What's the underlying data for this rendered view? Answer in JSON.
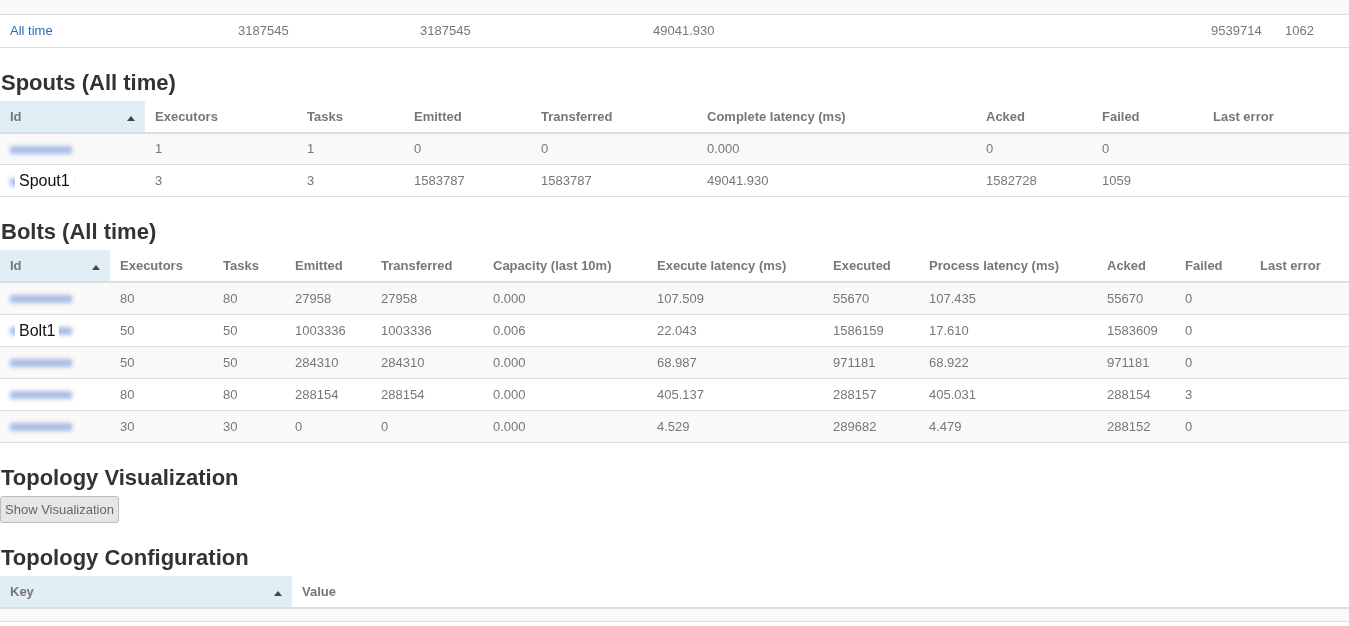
{
  "stats_table": {
    "rows": [
      {
        "window": "All time",
        "cells": [
          "3187545",
          "3187545",
          "49041.930",
          "",
          "9539714",
          "1062"
        ]
      }
    ]
  },
  "spouts": {
    "title": "Spouts (All time)",
    "columns": [
      {
        "label": "Id",
        "sorted": true
      },
      {
        "label": "Executors",
        "sorted": false
      },
      {
        "label": "Tasks",
        "sorted": false
      },
      {
        "label": "Emitted",
        "sorted": false
      },
      {
        "label": "Transferred",
        "sorted": false
      },
      {
        "label": "Complete latency (ms)",
        "sorted": false
      },
      {
        "label": "Acked",
        "sorted": false
      },
      {
        "label": "Failed",
        "sorted": false
      },
      {
        "label": "Last error",
        "sorted": false
      }
    ],
    "rows": [
      {
        "redacted": true,
        "cells": [
          "",
          "1",
          "1",
          "0",
          "0",
          "0.000",
          "0",
          "0",
          ""
        ]
      },
      {
        "redacted": true,
        "cells": [
          "Spout1",
          "3",
          "3",
          "1583787",
          "1583787",
          "49041.930",
          "1582728",
          "1059",
          ""
        ]
      }
    ]
  },
  "bolts": {
    "title": "Bolts (All time)",
    "columns": [
      {
        "label": "Id",
        "sorted": true
      },
      {
        "label": "Executors",
        "sorted": false
      },
      {
        "label": "Tasks",
        "sorted": false
      },
      {
        "label": "Emitted",
        "sorted": false
      },
      {
        "label": "Transferred",
        "sorted": false
      },
      {
        "label": "Capacity (last 10m)",
        "sorted": false
      },
      {
        "label": "Execute latency (ms)",
        "sorted": false
      },
      {
        "label": "Executed",
        "sorted": false
      },
      {
        "label": "Process latency (ms)",
        "sorted": false
      },
      {
        "label": "Acked",
        "sorted": false
      },
      {
        "label": "Failed",
        "sorted": false
      },
      {
        "label": "Last error",
        "sorted": false
      }
    ],
    "rows": [
      {
        "redacted": true,
        "cells": [
          "",
          "80",
          "80",
          "27958",
          "27958",
          "0.000",
          "107.509",
          "55670",
          "107.435",
          "55670",
          "0",
          ""
        ]
      },
      {
        "redacted": true,
        "cells": [
          "Bolt1",
          "50",
          "50",
          "1003336",
          "1003336",
          "0.006",
          "22.043",
          "1586159",
          "17.610",
          "1583609",
          "0",
          ""
        ]
      },
      {
        "redacted": true,
        "cells": [
          "",
          "50",
          "50",
          "284310",
          "284310",
          "0.000",
          "68.987",
          "971181",
          "68.922",
          "971181",
          "0",
          ""
        ]
      },
      {
        "redacted": true,
        "cells": [
          "",
          "80",
          "80",
          "288154",
          "288154",
          "0.000",
          "405.137",
          "288157",
          "405.031",
          "288154",
          "3",
          ""
        ]
      },
      {
        "redacted": true,
        "cells": [
          "",
          "30",
          "30",
          "0",
          "0",
          "0.000",
          "4.529",
          "289682",
          "4.479",
          "288152",
          "0",
          ""
        ]
      }
    ]
  },
  "visualization": {
    "title": "Topology Visualization",
    "button": "Show Visualization"
  },
  "configuration": {
    "title": "Topology Configuration",
    "columns": [
      {
        "label": "Key",
        "sorted": true
      },
      {
        "label": "Value",
        "sorted": false
      }
    ]
  }
}
